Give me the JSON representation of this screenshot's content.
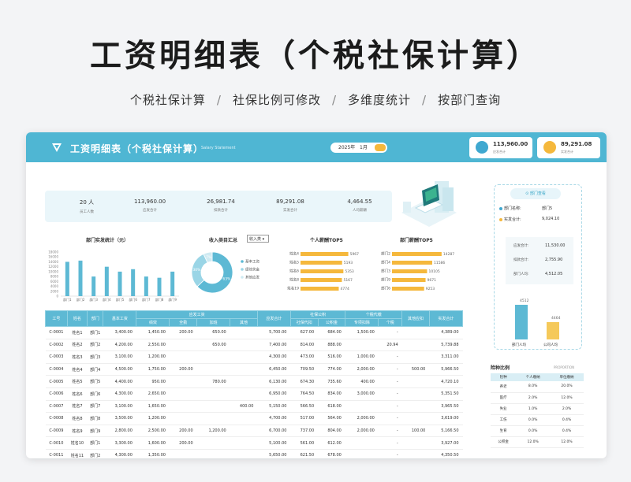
{
  "hero": {
    "title": "工资明细表（个税社保计算）",
    "features": [
      "个税社保计算",
      "社保比例可修改",
      "多维度统计",
      "按部门查询"
    ],
    "sep": "/"
  },
  "app": {
    "title": "工资明细表（个税社保计算）",
    "subtitle": "Salary Statement",
    "date_year": "2025年",
    "date_month": "1月",
    "cards": [
      {
        "value": "113,960.00",
        "label": "应发合计",
        "color": "#3fa8d0"
      },
      {
        "value": "89,291.08",
        "label": "实发合计",
        "color": "#f5b83c"
      }
    ],
    "brand_color": "#4fb6d3",
    "accent": "#f5b83c"
  },
  "stats": [
    {
      "value": "20 人",
      "label": "员工人数"
    },
    {
      "value": "113,960.00",
      "label": "应发合计"
    },
    {
      "value": "26,981.74",
      "label": "扣款合计"
    },
    {
      "value": "89,291.08",
      "label": "实发合计"
    },
    {
      "value": "4,464.55",
      "label": "人均薪酬"
    }
  ],
  "charts": {
    "dept_title": "部门实发统计（元）",
    "pie_title": "收入类目汇总",
    "pie_select": "收入类",
    "top_title": "个人薪酬TOP5",
    "dept_top_title": "部门薪酬TOP5"
  },
  "chart_data": [
    {
      "type": "bar",
      "title": "部门实发统计（元）",
      "categories": [
        "部门1",
        "部门2",
        "部门3",
        "部门4",
        "部门5",
        "部门6",
        "部门7",
        "部门8",
        "部门9"
      ],
      "values": [
        14000,
        14500,
        8000,
        12000,
        10000,
        11000,
        8000,
        7500,
        10000
      ],
      "ylim": [
        0,
        18000
      ],
      "yticks": [
        "0",
        "2000",
        "4000",
        "6000",
        "8000",
        "10000",
        "12000",
        "14000",
        "16000",
        "18000"
      ]
    },
    {
      "type": "pie",
      "title": "收入类目汇总",
      "slices": [
        {
          "name": "基本工资",
          "value": 63
        },
        {
          "name": "绩效奖金",
          "value": 30
        },
        {
          "name": "其他应发",
          "value": 7
        }
      ],
      "labels": [
        "63%",
        "30%",
        "7%"
      ]
    },
    {
      "type": "bar",
      "title": "个人薪酬TOP5",
      "categories": [
        "姓名4",
        "姓名5",
        "姓名6",
        "姓名8",
        "姓名19"
      ],
      "values": [
        5967,
        5193,
        5353,
        5167,
        4774
      ],
      "labels": [
        "5967",
        "5193",
        "5353",
        "5167",
        "4774"
      ]
    },
    {
      "type": "bar",
      "title": "部门薪酬TOP5",
      "categories": [
        "部门2",
        "部门4",
        "部门3",
        "部门9",
        "部门6"
      ],
      "values": [
        14287,
        11586,
        10105,
        9671,
        9253
      ],
      "labels": [
        "14287",
        "11586",
        "10105",
        "9671",
        "9253"
      ]
    }
  ],
  "table": {
    "groups": [
      "应发工资",
      "社保公积",
      "个税代缴"
    ],
    "headers": [
      "工号",
      "姓名",
      "部门",
      "基本工资",
      "绩效",
      "全勤",
      "加班",
      "其他",
      "应发合计",
      "社保代扣",
      "公积金",
      "专项扣除",
      "个税",
      "其他应扣",
      "实发合计"
    ],
    "rows": [
      [
        "C-0001",
        "姓名1",
        "部门1",
        "3,400.00",
        "1,450.00",
        "200.00",
        "650.00",
        "",
        "5,700.00",
        "627.00",
        "684.00",
        "1,500.00",
        "-",
        "",
        "4,389.00"
      ],
      [
        "C-0002",
        "姓名2",
        "部门2",
        "4,200.00",
        "2,550.00",
        "",
        "650.00",
        "",
        "7,400.00",
        "814.00",
        "888.00",
        "",
        "20.94",
        "",
        "5,739.88"
      ],
      [
        "C-0003",
        "姓名3",
        "部门3",
        "3,100.00",
        "1,200.00",
        "",
        "",
        "",
        "4,300.00",
        "473.00",
        "516.00",
        "1,000.00",
        "-",
        "",
        "3,311.00"
      ],
      [
        "C-0004",
        "姓名4",
        "部门4",
        "4,500.00",
        "1,750.00",
        "200.00",
        "",
        "",
        "6,450.00",
        "709.50",
        "774.00",
        "2,000.00",
        "-",
        "500.00",
        "5,966.50"
      ],
      [
        "C-0005",
        "姓名5",
        "部门5",
        "4,400.00",
        "950.00",
        "",
        "780.00",
        "",
        "6,130.00",
        "674.30",
        "735.60",
        "400.00",
        "-",
        "",
        "4,720.10"
      ],
      [
        "C-0006",
        "姓名6",
        "部门6",
        "4,300.00",
        "2,650.00",
        "",
        "",
        "",
        "6,950.00",
        "764.50",
        "834.00",
        "3,000.00",
        "-",
        "",
        "5,351.50"
      ],
      [
        "C-0007",
        "姓名7",
        "部门7",
        "3,100.00",
        "1,650.00",
        "",
        "",
        "400.00",
        "5,150.00",
        "566.50",
        "618.00",
        "",
        "-",
        "",
        "3,965.50"
      ],
      [
        "C-0008",
        "姓名8",
        "部门8",
        "3,500.00",
        "1,200.00",
        "",
        "",
        "",
        "4,700.00",
        "517.00",
        "564.00",
        "2,000.00",
        "-",
        "",
        "3,619.00"
      ],
      [
        "C-0009",
        "姓名9",
        "部门9",
        "2,800.00",
        "2,500.00",
        "200.00",
        "1,200.00",
        "",
        "6,700.00",
        "737.00",
        "804.00",
        "2,000.00",
        "-",
        "100.00",
        "5,166.50"
      ],
      [
        "C-0010",
        "姓名10",
        "部门1",
        "3,300.00",
        "1,600.00",
        "200.00",
        "",
        "",
        "5,100.00",
        "561.00",
        "612.00",
        "",
        "-",
        "",
        "3,927.00"
      ],
      [
        "C-0011",
        "姓名11",
        "部门2",
        "4,300.00",
        "1,350.00",
        "",
        "",
        "",
        "5,650.00",
        "621.50",
        "678.00",
        "",
        "-",
        "",
        "4,350.50"
      ]
    ]
  },
  "side": {
    "query_btn": "部门查看",
    "dept_label": "部门名称:",
    "dept_value": "部门5",
    "paid_label": "实发合计:",
    "paid_value": "9,024.10",
    "mini": [
      {
        "label": "应发合计:",
        "value": "11,530.00"
      },
      {
        "label": "扣款合计:",
        "value": "2,755.90"
      },
      {
        "label": "部门人均:",
        "value": "4,512.05"
      }
    ],
    "bar_labels": [
      "部门人均",
      "公司人均"
    ],
    "bar_values": [
      "4512",
      "4464"
    ],
    "ratio_title": "险种比例",
    "ratio_en": "PROPORTION",
    "ratio_headers": [
      "险种",
      "个人缴纳",
      "单位缴纳"
    ],
    "ratio_rows": [
      [
        "养老",
        "8.0%",
        "20.0%"
      ],
      [
        "医疗",
        "2.0%",
        "12.0%"
      ],
      [
        "失业",
        "1.0%",
        "2.0%"
      ],
      [
        "工伤",
        "0.0%",
        "0.4%"
      ],
      [
        "生育",
        "0.0%",
        "0.4%"
      ],
      [
        "公积金",
        "12.0%",
        "12.0%"
      ]
    ]
  }
}
